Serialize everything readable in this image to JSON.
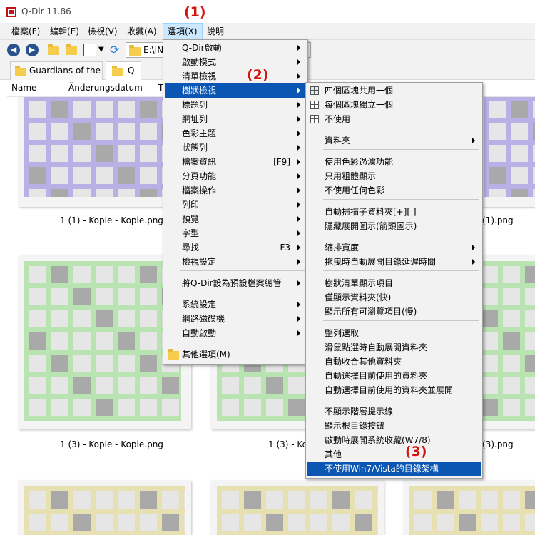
{
  "app": {
    "title": "Q-Dir 11.86"
  },
  "annotations": [
    "(1)",
    "(2)",
    "(3)"
  ],
  "menubar": [
    "檔案(F)",
    "編輯(E)",
    "檢視(V)",
    "收藏(A)",
    "選項(X)",
    "說明"
  ],
  "address": {
    "value": "E:\\INI"
  },
  "tabs": [
    "Guardians of the ...",
    "Q"
  ],
  "columns": [
    "Name",
    "Änderungsdatum",
    "T"
  ],
  "files": [
    "1 (1) - Kopie - Kopie.png",
    "(1).png",
    "1 (3) - Kopie - Kopie.png",
    "1 (3) - Ko",
    "(3).png"
  ],
  "options_menu": [
    {
      "label": "Q-Dir啟動",
      "arrow": true
    },
    {
      "label": "啟動模式",
      "arrow": true
    },
    {
      "label": "清單檢視",
      "arrow": true
    },
    {
      "label": "樹狀檢視",
      "arrow": true
    },
    {
      "label": "標題列",
      "arrow": true
    },
    {
      "label": "網址列",
      "arrow": true
    },
    {
      "label": "色彩主題",
      "arrow": true
    },
    {
      "label": "狀態列",
      "arrow": true
    },
    {
      "label": "檔案資訊",
      "shortcut": "[F9]",
      "arrow": true
    },
    {
      "label": "分頁功能",
      "arrow": true
    },
    {
      "label": "檔案操作",
      "arrow": true
    },
    {
      "label": "列印",
      "arrow": true
    },
    {
      "label": "預覽",
      "arrow": true
    },
    {
      "label": "字型",
      "arrow": true
    },
    {
      "label": "尋找",
      "shortcut": "F3",
      "arrow": true
    },
    {
      "label": "檢視設定",
      "arrow": true
    },
    {
      "label": "將Q-Dir設為預設檔案總管",
      "arrow": true
    },
    {
      "label": "系統設定",
      "arrow": true
    },
    {
      "label": "網路磁碟機",
      "arrow": true
    },
    {
      "label": "自動啟動",
      "arrow": true
    },
    {
      "label": "其他選項(M)",
      "arrow": false
    }
  ],
  "tree_menu": [
    {
      "label": "四個區塊共用一個"
    },
    {
      "label": "每個區塊獨立一個"
    },
    {
      "label": "不使用"
    },
    {
      "label": "資料夾",
      "arrow": true
    },
    {
      "label": "使用色彩過濾功能"
    },
    {
      "label": "只用粗體顯示"
    },
    {
      "label": "不使用任何色彩"
    },
    {
      "label": "自動掃描子資料夾[+][ ]"
    },
    {
      "label": "隱藏展開圖示(箭頭圖示)"
    },
    {
      "label": "縮排寬度",
      "arrow": true
    },
    {
      "label": "拖曳時自動展開目錄延遲時間",
      "arrow": true
    },
    {
      "label": "樹狀清單顯示項目"
    },
    {
      "label": "僅顯示資料夾(快)"
    },
    {
      "label": "顯示所有可瀏覽項目(慢)"
    },
    {
      "label": "整列選取"
    },
    {
      "label": "滑鼠點選時自動展開資料夾"
    },
    {
      "label": "自動收合其他資料夾"
    },
    {
      "label": "自動選擇目前使用的資料夾"
    },
    {
      "label": "自動選擇目前使用的資料夾並展開"
    },
    {
      "label": "不顯示階層提示線"
    },
    {
      "label": "顯示根目錄按鈕"
    },
    {
      "label": "啟動時展開系統收藏(W7/8)"
    },
    {
      "label": "其他"
    },
    {
      "label": "不使用Win7/Vista的目錄架構"
    }
  ],
  "colors": {
    "accent": "#0b56b3",
    "annotation": "#d1160f",
    "purple_cell": "#b7b1e6",
    "green_cell": "#b9e3b1",
    "yellow_cell": "#e6e0b3"
  }
}
